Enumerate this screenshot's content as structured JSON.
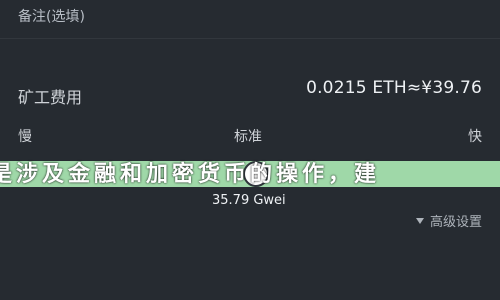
{
  "memo": {
    "label": "备注(选填)"
  },
  "fee": {
    "label": "矿工费用",
    "value": "0.0215 ETH≈¥39.76"
  },
  "speed": {
    "slow": "慢",
    "normal": "标准",
    "fast": "快"
  },
  "banner": {
    "text": "是涉及金融和加密货币的操作，建"
  },
  "gas": {
    "value": "35.79 Gwei"
  },
  "advanced": {
    "label": "高级设置"
  },
  "colors": {
    "background": "#262b31",
    "slider": "#9fd8a8"
  },
  "icons": {
    "advanced_toggle": "chevron-down-icon"
  },
  "slider": {
    "level_fraction": 0.5
  }
}
